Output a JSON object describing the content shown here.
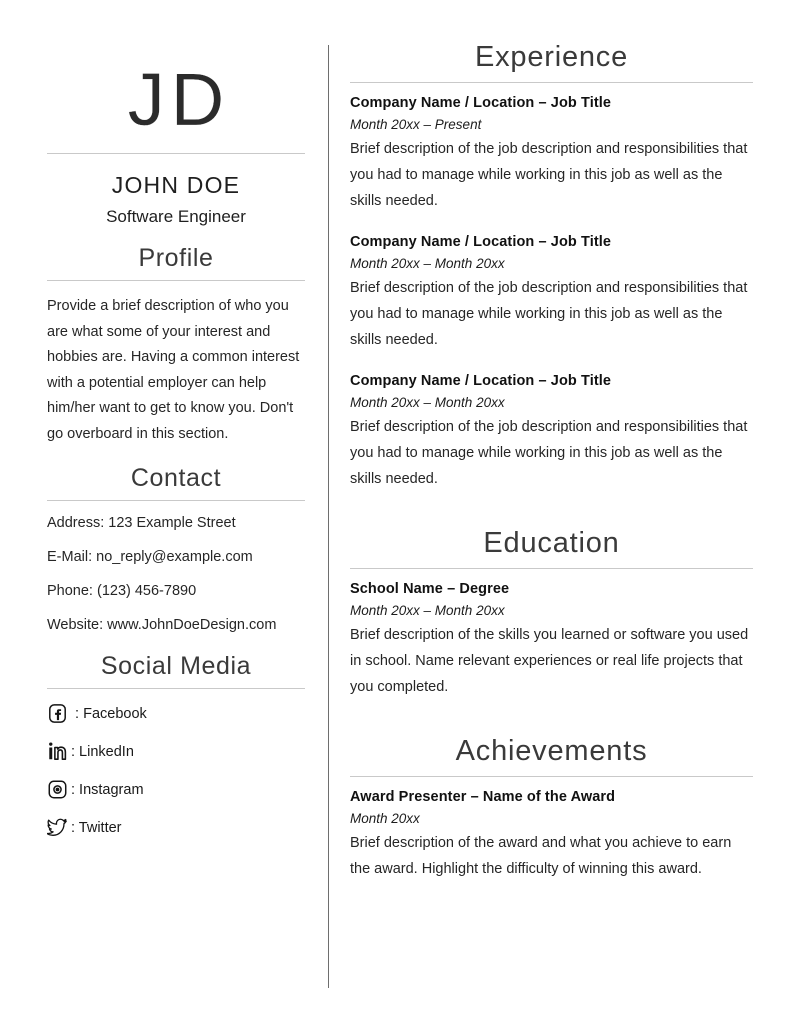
{
  "header": {
    "monogram": "JD",
    "name": "JOHN DOE",
    "role": "Software Engineer"
  },
  "left": {
    "profile": {
      "heading": "Profile",
      "text": "Provide a brief description of who you are what some of your interest and hobbies are. Having a common interest with a potential employer can help him/her want to get to know you. Don't go overboard in this section."
    },
    "contact": {
      "heading": "Contact",
      "items": [
        "Address: 123 Example Street",
        "E-Mail: no_reply@example.com",
        "Phone: (123) 456-7890",
        "Website: www.JohnDoeDesign.com"
      ]
    },
    "social": {
      "heading": "Social Media",
      "items": [
        {
          "icon": "facebook-icon",
          "label": " : Facebook"
        },
        {
          "icon": "linkedin-icon",
          "label": ": LinkedIn"
        },
        {
          "icon": "instagram-icon",
          "label": ": Instagram"
        },
        {
          "icon": "twitter-icon",
          "label": ": Twitter"
        }
      ]
    }
  },
  "right": {
    "experience": {
      "heading": "Experience",
      "entries": [
        {
          "title": "Company Name / Location – Job Title",
          "date": "Month 20xx – Present",
          "desc": "Brief description of the job description and responsibilities that you had to manage while working in this job as well as the skills needed."
        },
        {
          "title": "Company Name / Location – Job Title",
          "date": "Month 20xx – Month 20xx",
          "desc": "Brief description of the job description and responsibilities that you had to manage while working in this job as well as the skills needed."
        },
        {
          "title": "Company Name / Location – Job Title",
          "date": "Month 20xx – Month 20xx",
          "desc": "Brief description of the job description and responsibilities that you had to manage while working in this job as well as the skills needed."
        }
      ]
    },
    "education": {
      "heading": "Education",
      "entries": [
        {
          "title": "School Name – Degree",
          "date": "Month 20xx – Month 20xx",
          "desc": "Brief description of the skills you learned or software you used in school. Name relevant experiences or real life projects that you completed."
        }
      ]
    },
    "achievements": {
      "heading": "Achievements",
      "entries": [
        {
          "title": "Award Presenter – Name of the Award",
          "date": "Month 20xx",
          "desc": "Brief description of the award and what you achieve to earn the award. Highlight the difficulty of winning this award."
        }
      ]
    }
  },
  "colors": {
    "text": "#262626",
    "rule": "#c9c9c9",
    "divider": "#6e6e6e",
    "background": "#ffffff"
  }
}
